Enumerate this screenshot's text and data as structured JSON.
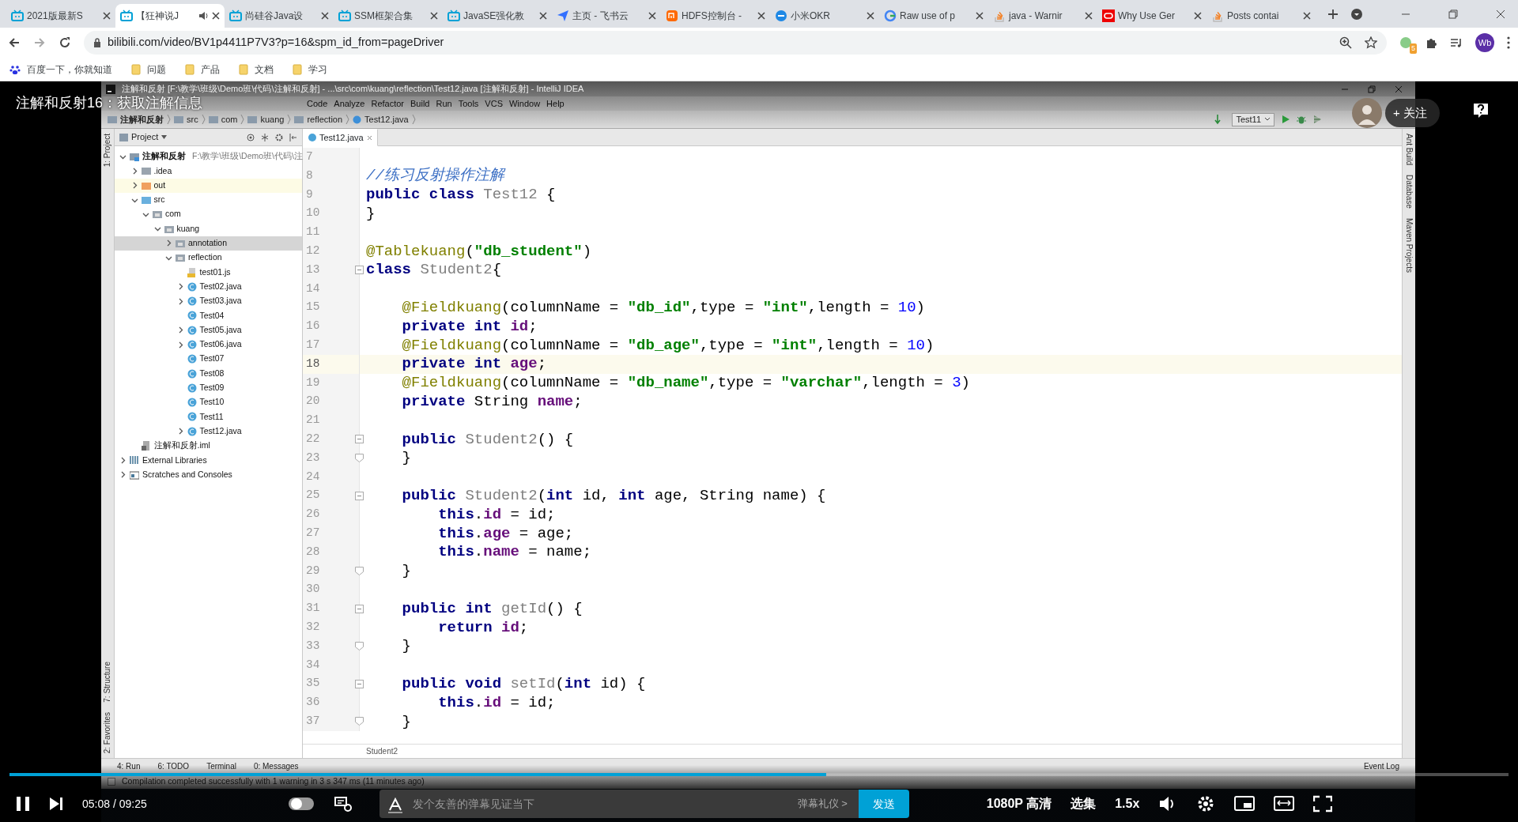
{
  "browser": {
    "tabs": [
      {
        "title": "2021版最新S",
        "kind": "bilibili",
        "selected": false,
        "audio": false
      },
      {
        "title": "【狂神说J",
        "kind": "bilibili",
        "selected": true,
        "audio": true
      },
      {
        "title": "尚硅谷Java设",
        "kind": "bilibili",
        "selected": false,
        "audio": false
      },
      {
        "title": "SSM框架合集",
        "kind": "bilibili",
        "selected": false,
        "audio": false
      },
      {
        "title": "JavaSE强化教",
        "kind": "bilibili",
        "selected": false,
        "audio": false
      },
      {
        "title": "主页 - 飞书云",
        "kind": "plane",
        "selected": false,
        "audio": false
      },
      {
        "title": "HDFS控制台 -",
        "kind": "mi",
        "selected": false,
        "audio": false
      },
      {
        "title": "小米OKR",
        "kind": "okr",
        "selected": false,
        "audio": false
      },
      {
        "title": "Raw use of p",
        "kind": "g",
        "selected": false,
        "audio": false
      },
      {
        "title": "java - Warnir",
        "kind": "stack",
        "selected": false,
        "audio": false
      },
      {
        "title": "Why Use Ger",
        "kind": "oracle",
        "selected": false,
        "audio": false
      },
      {
        "title": "Posts contai",
        "kind": "stack",
        "selected": false,
        "audio": false
      }
    ],
    "address": "bilibili.com/video/BV1p4411P7V3?p=16&spm_id_from=pageDriver",
    "extension_badge": "5",
    "profile": "Wb",
    "bookmarks": [
      {
        "label": "百度一下，你就知道",
        "kind": "paw"
      },
      {
        "label": "问题",
        "kind": "folder"
      },
      {
        "label": "产品",
        "kind": "folder"
      },
      {
        "label": "文档",
        "kind": "folder"
      },
      {
        "label": "学习",
        "kind": "folder"
      }
    ]
  },
  "video": {
    "title": "注解和反射16：获取注解信息",
    "follow": "+ 关注"
  },
  "ide": {
    "title": "注解和反射 [F:\\教学\\班级\\Demo班\\代码\\注解和反射] - ...\\src\\com\\kuang\\reflection\\Test12.java [注解和反射] - IntelliJ IDEA",
    "menu": [
      "Code",
      "Analyze",
      "Refactor",
      "Build",
      "Run",
      "Tools",
      "VCS",
      "Window",
      "Help"
    ],
    "breadcrumbs": [
      "注解和反射",
      "src",
      "com",
      "kuang",
      "reflection",
      "Test12.java"
    ],
    "run_config": "Test11",
    "left_tools": [
      "1: Project",
      "7: Structure",
      "2: Favorites"
    ],
    "right_tools": [
      "Ant Build",
      "Database",
      "Maven Projects"
    ],
    "project_header": "Project",
    "tree": [
      {
        "label": "注解和反射",
        "hint": "F:\\教学\\班级\\Demo班\\代码\\注",
        "kind": "module",
        "expanded": true,
        "selected": false,
        "children": [
          {
            "label": ".idea",
            "kind": "folder",
            "expanded": false,
            "selected": false
          },
          {
            "label": "out",
            "kind": "excluded",
            "expanded": false,
            "selected": false
          },
          {
            "label": "src",
            "kind": "source",
            "expanded": true,
            "selected": false,
            "children": [
              {
                "label": "com",
                "kind": "package",
                "expanded": true,
                "selected": false,
                "children": [
                  {
                    "label": "kuang",
                    "kind": "package",
                    "expanded": true,
                    "selected": false,
                    "children": [
                      {
                        "label": "annotation",
                        "kind": "package",
                        "expanded": false,
                        "selected": true
                      },
                      {
                        "label": "reflection",
                        "kind": "package",
                        "expanded": true,
                        "selected": false,
                        "children": [
                          {
                            "label": "test01.js",
                            "kind": "js",
                            "selected": false
                          },
                          {
                            "label": "Test02.java",
                            "kind": "class",
                            "expanded": false,
                            "selected": false
                          },
                          {
                            "label": "Test03.java",
                            "kind": "class",
                            "expanded": false,
                            "selected": false
                          },
                          {
                            "label": "Test04",
                            "kind": "class",
                            "selected": false
                          },
                          {
                            "label": "Test05.java",
                            "kind": "class",
                            "expanded": false,
                            "selected": false
                          },
                          {
                            "label": "Test06.java",
                            "kind": "class",
                            "expanded": false,
                            "selected": false
                          },
                          {
                            "label": "Test07",
                            "kind": "class",
                            "selected": false
                          },
                          {
                            "label": "Test08",
                            "kind": "class",
                            "selected": false
                          },
                          {
                            "label": "Test09",
                            "kind": "class",
                            "selected": false
                          },
                          {
                            "label": "Test10",
                            "kind": "class",
                            "selected": false
                          },
                          {
                            "label": "Test11",
                            "kind": "class",
                            "selected": false
                          },
                          {
                            "label": "Test12.java",
                            "kind": "class",
                            "expanded": false,
                            "selected": false
                          }
                        ]
                      }
                    ]
                  }
                ]
              }
            ]
          },
          {
            "label": "注解和反射.iml",
            "kind": "iml",
            "selected": false
          }
        ]
      },
      {
        "label": "External Libraries",
        "kind": "library",
        "expanded": false,
        "selected": false
      },
      {
        "label": "Scratches and Consoles",
        "kind": "scratch",
        "expanded": false,
        "selected": false
      }
    ],
    "editor_tab": "Test12.java",
    "lines": [
      {
        "number": "7",
        "current": false
      },
      {
        "number": "8",
        "current": false,
        "tokens": [
          {
            "kind": "comment",
            "text": "//练习反射操作注解"
          }
        ]
      },
      {
        "number": "9",
        "current": false,
        "tokens": [
          {
            "kind": "kw",
            "text": "public class "
          },
          {
            "kind": "unused",
            "text": "Test12"
          },
          {
            "kind": "plain",
            "text": " {"
          }
        ]
      },
      {
        "number": "10",
        "current": false,
        "tokens": [
          {
            "kind": "plain",
            "text": "}"
          }
        ]
      },
      {
        "number": "11",
        "current": false
      },
      {
        "number": "12",
        "current": false,
        "tokens": [
          {
            "kind": "annotation",
            "text": "@Tablekuang"
          },
          {
            "kind": "plain",
            "text": "("
          },
          {
            "kind": "string",
            "text": "\"db_student\""
          },
          {
            "kind": "plain",
            "text": ")"
          }
        ]
      },
      {
        "number": "13",
        "current": false,
        "kind": "opener",
        "tokens": [
          {
            "kind": "kw",
            "text": "class "
          },
          {
            "kind": "unused",
            "text": "Student2"
          },
          {
            "kind": "plain",
            "text": "{"
          }
        ]
      },
      {
        "number": "14",
        "current": false
      },
      {
        "number": "15",
        "current": false,
        "tokens": [
          {
            "kind": "annotation",
            "text": "    @Fieldkuang"
          },
          {
            "kind": "plain",
            "text": "(columnName = "
          },
          {
            "kind": "string",
            "text": "\"db_id\""
          },
          {
            "kind": "plain",
            "text": ",type = "
          },
          {
            "kind": "string",
            "text": "\"int\""
          },
          {
            "kind": "plain",
            "text": ",length = "
          },
          {
            "kind": "number",
            "text": "10"
          },
          {
            "kind": "plain",
            "text": ")"
          }
        ]
      },
      {
        "number": "16",
        "current": false,
        "tokens": [
          {
            "kind": "kw",
            "text": "    private int "
          },
          {
            "kind": "field",
            "text": "id"
          },
          {
            "kind": "plain",
            "text": ";"
          }
        ]
      },
      {
        "number": "17",
        "current": false,
        "tokens": [
          {
            "kind": "annotation",
            "text": "    @Fieldkuang"
          },
          {
            "kind": "plain",
            "text": "(columnName = "
          },
          {
            "kind": "string",
            "text": "\"db_age\""
          },
          {
            "kind": "plain",
            "text": ",type = "
          },
          {
            "kind": "string",
            "text": "\"int\""
          },
          {
            "kind": "plain",
            "text": ",length = "
          },
          {
            "kind": "number",
            "text": "10"
          },
          {
            "kind": "plain",
            "text": ")"
          }
        ]
      },
      {
        "number": "18",
        "current": true,
        "tokens": [
          {
            "kind": "kw",
            "text": "    private int "
          },
          {
            "kind": "field",
            "text": "age"
          },
          {
            "kind": "plain",
            "text": ";"
          }
        ]
      },
      {
        "number": "19",
        "current": false,
        "tokens": [
          {
            "kind": "annotation",
            "text": "    @Fieldkuang"
          },
          {
            "kind": "plain",
            "text": "(columnName = "
          },
          {
            "kind": "string",
            "text": "\"db_name\""
          },
          {
            "kind": "plain",
            "text": ",type = "
          },
          {
            "kind": "string",
            "text": "\"varchar\""
          },
          {
            "kind": "plain",
            "text": ",length = "
          },
          {
            "kind": "number",
            "text": "3"
          },
          {
            "kind": "plain",
            "text": ")"
          }
        ]
      },
      {
        "number": "20",
        "current": false,
        "tokens": [
          {
            "kind": "kw",
            "text": "    private "
          },
          {
            "kind": "plain",
            "text": "String "
          },
          {
            "kind": "field",
            "text": "name"
          },
          {
            "kind": "plain",
            "text": ";"
          }
        ]
      },
      {
        "number": "21",
        "current": false
      },
      {
        "number": "22",
        "current": false,
        "kind": "opener",
        "tokens": [
          {
            "kind": "kw",
            "text": "    public "
          },
          {
            "kind": "unused",
            "text": "Student2"
          },
          {
            "kind": "plain",
            "text": "() {"
          }
        ]
      },
      {
        "number": "23",
        "current": false,
        "kind": "closer",
        "tokens": [
          {
            "kind": "plain",
            "text": "    }"
          }
        ]
      },
      {
        "number": "24",
        "current": false
      },
      {
        "number": "25",
        "current": false,
        "kind": "opener",
        "tokens": [
          {
            "kind": "kw",
            "text": "    public "
          },
          {
            "kind": "unused",
            "text": "Student2"
          },
          {
            "kind": "plain",
            "text": "("
          },
          {
            "kind": "kw",
            "text": "int "
          },
          {
            "kind": "plain",
            "text": "id, "
          },
          {
            "kind": "kw",
            "text": "int "
          },
          {
            "kind": "plain",
            "text": "age, String name) {"
          }
        ]
      },
      {
        "number": "26",
        "current": false,
        "tokens": [
          {
            "kind": "kw",
            "text": "        this"
          },
          {
            "kind": "plain",
            "text": "."
          },
          {
            "kind": "field",
            "text": "id"
          },
          {
            "kind": "plain",
            "text": " = id;"
          }
        ]
      },
      {
        "number": "27",
        "current": false,
        "tokens": [
          {
            "kind": "kw",
            "text": "        this"
          },
          {
            "kind": "plain",
            "text": "."
          },
          {
            "kind": "field",
            "text": "age"
          },
          {
            "kind": "plain",
            "text": " = age;"
          }
        ]
      },
      {
        "number": "28",
        "current": false,
        "tokens": [
          {
            "kind": "kw",
            "text": "        this"
          },
          {
            "kind": "plain",
            "text": "."
          },
          {
            "kind": "field",
            "text": "name"
          },
          {
            "kind": "plain",
            "text": " = name;"
          }
        ]
      },
      {
        "number": "29",
        "current": false,
        "kind": "closer",
        "tokens": [
          {
            "kind": "plain",
            "text": "    }"
          }
        ]
      },
      {
        "number": "30",
        "current": false
      },
      {
        "number": "31",
        "current": false,
        "kind": "opener",
        "tokens": [
          {
            "kind": "kw",
            "text": "    public int "
          },
          {
            "kind": "unused",
            "text": "getId"
          },
          {
            "kind": "plain",
            "text": "() {"
          }
        ]
      },
      {
        "number": "32",
        "current": false,
        "tokens": [
          {
            "kind": "kw",
            "text": "        return "
          },
          {
            "kind": "field",
            "text": "id"
          },
          {
            "kind": "plain",
            "text": ";"
          }
        ]
      },
      {
        "number": "33",
        "current": false,
        "kind": "closer",
        "tokens": [
          {
            "kind": "plain",
            "text": "    }"
          }
        ]
      },
      {
        "number": "34",
        "current": false
      },
      {
        "number": "35",
        "current": false,
        "kind": "opener",
        "tokens": [
          {
            "kind": "kw",
            "text": "    public void "
          },
          {
            "kind": "unused",
            "text": "setId"
          },
          {
            "kind": "plain",
            "text": "("
          },
          {
            "kind": "kw",
            "text": "int "
          },
          {
            "kind": "plain",
            "text": "id) {"
          }
        ]
      },
      {
        "number": "36",
        "current": false,
        "tokens": [
          {
            "kind": "kw",
            "text": "        this"
          },
          {
            "kind": "plain",
            "text": "."
          },
          {
            "kind": "field",
            "text": "id"
          },
          {
            "kind": "plain",
            "text": " = id;"
          }
        ]
      },
      {
        "number": "37",
        "current": false,
        "kind": "closer",
        "tokens": [
          {
            "kind": "plain",
            "text": "    }"
          }
        ]
      }
    ],
    "footer_crumb": "Student2",
    "bottom_tools": [
      "4: Run",
      "6: TODO",
      "Terminal",
      "0: Messages"
    ],
    "event_log": "Event Log",
    "status": "Compilation completed successfully with 1 warning in 3 s 347 ms (11 minutes ago)"
  },
  "player": {
    "level": 0.545,
    "time": "05:08 / 09:25",
    "danmaku_placeholder": "发个友善的弹幕见证当下",
    "etiquette": "弹幕礼仪 >",
    "send": "发送",
    "quality": "1080P 高清",
    "episodes": "选集",
    "speed": "1.5x"
  }
}
